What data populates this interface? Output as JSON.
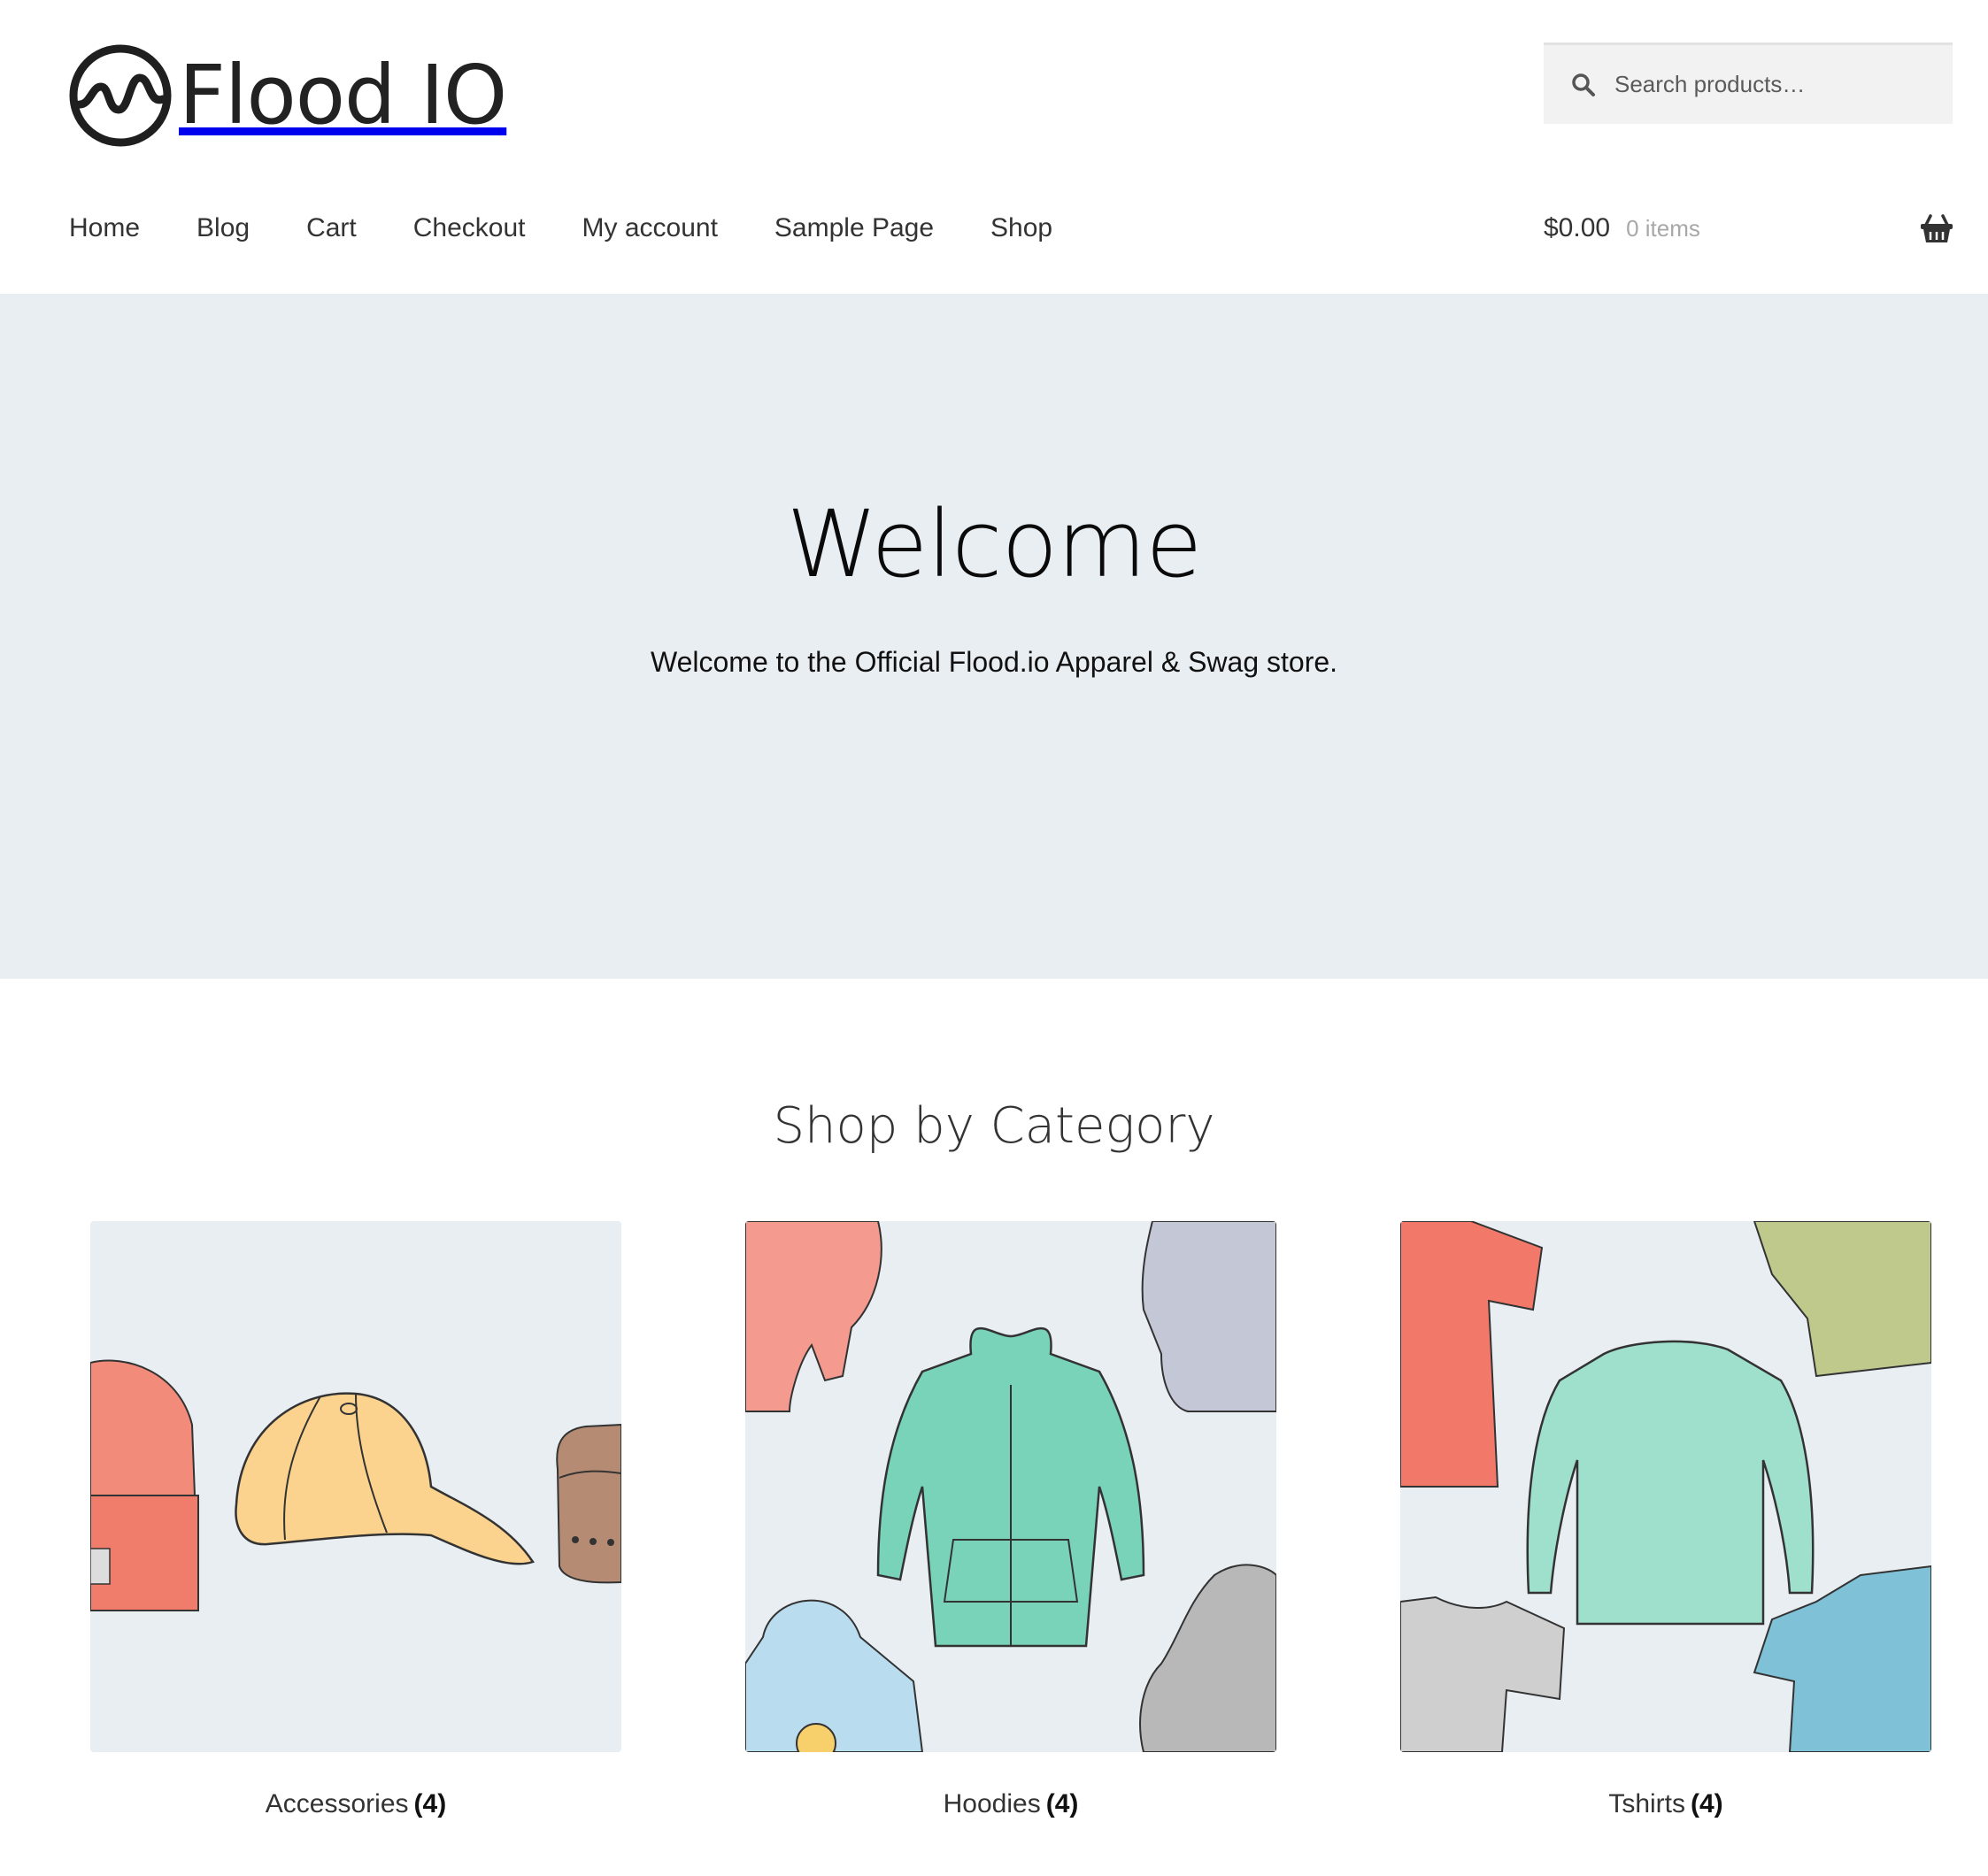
{
  "brand": {
    "name": "Flood IO"
  },
  "search": {
    "placeholder": "Search products…"
  },
  "nav": {
    "items": [
      {
        "label": "Home"
      },
      {
        "label": "Blog"
      },
      {
        "label": "Cart"
      },
      {
        "label": "Checkout"
      },
      {
        "label": "My account"
      },
      {
        "label": "Sample Page"
      },
      {
        "label": "Shop"
      }
    ]
  },
  "cart": {
    "amount": "$0.00",
    "count": "0 items"
  },
  "hero": {
    "title": "Welcome",
    "text": "Welcome to the Official Flood.io Apparel & Swag store."
  },
  "categories": {
    "title": "Shop by Category",
    "items": [
      {
        "name": "Accessories",
        "count": "(4)",
        "image": "accessories-illustration"
      },
      {
        "name": "Hoodies",
        "count": "(4)",
        "image": "hoodies-illustration"
      },
      {
        "name": "Tshirts",
        "count": "(4)",
        "image": "tshirts-illustration"
      }
    ]
  },
  "colors": {
    "hero_bg": "#e9eef2",
    "text": "#333333",
    "muted": "#a8a8a8"
  }
}
